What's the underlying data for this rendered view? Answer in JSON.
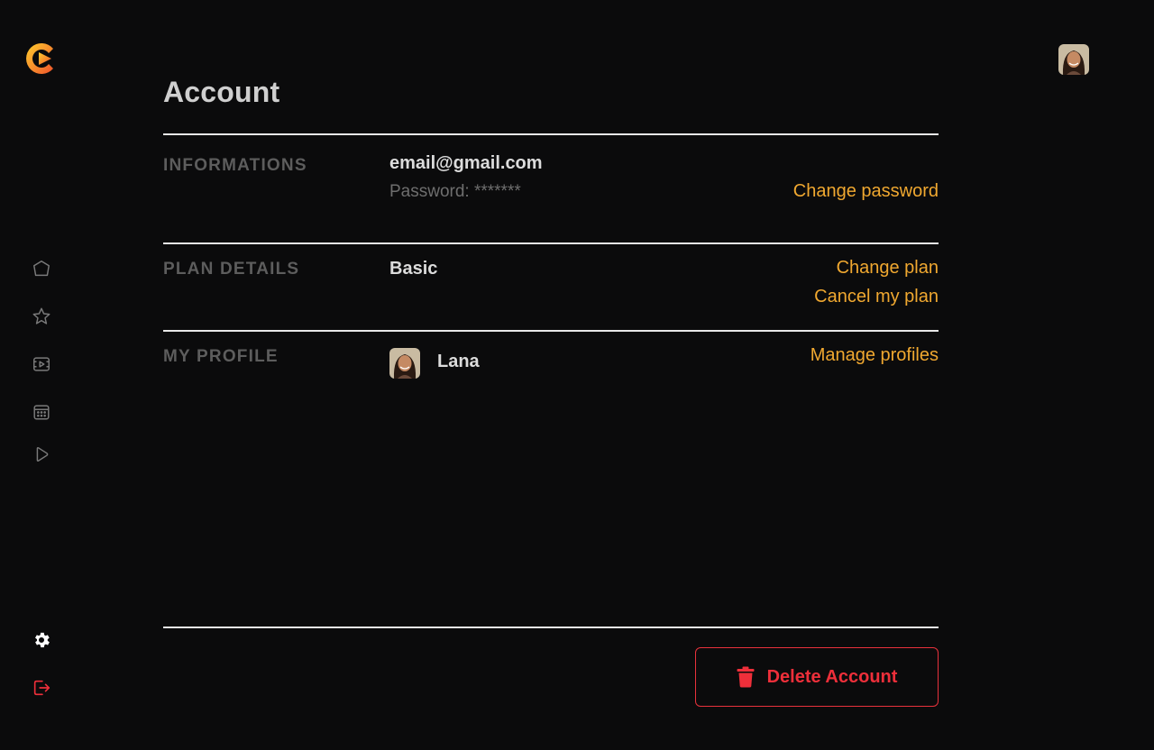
{
  "page": {
    "title": "Account"
  },
  "sidebar": {
    "nav": [
      {
        "icon": "home-icon"
      },
      {
        "icon": "star-icon"
      },
      {
        "icon": "video-icon"
      },
      {
        "icon": "calendar-icon"
      },
      {
        "icon": "play-icon"
      }
    ],
    "bottom": [
      {
        "icon": "gear-icon"
      },
      {
        "icon": "logout-icon"
      }
    ]
  },
  "sections": {
    "informations": {
      "label": "INFORMATIONS",
      "email": "email@gmail.com",
      "password": "Password: *******",
      "action": "Change password"
    },
    "plan": {
      "label": "PLAN DETAILS",
      "value": "Basic",
      "actions": [
        "Change plan",
        "Cancel my plan"
      ]
    },
    "profile": {
      "label": "MY PROFILE",
      "name": "Lana",
      "action": "Manage profiles"
    }
  },
  "delete": {
    "label": "Delete Account"
  },
  "colors": {
    "accent": "#f0a830",
    "danger": "#ee2f3a",
    "background": "#0b0b0c"
  }
}
